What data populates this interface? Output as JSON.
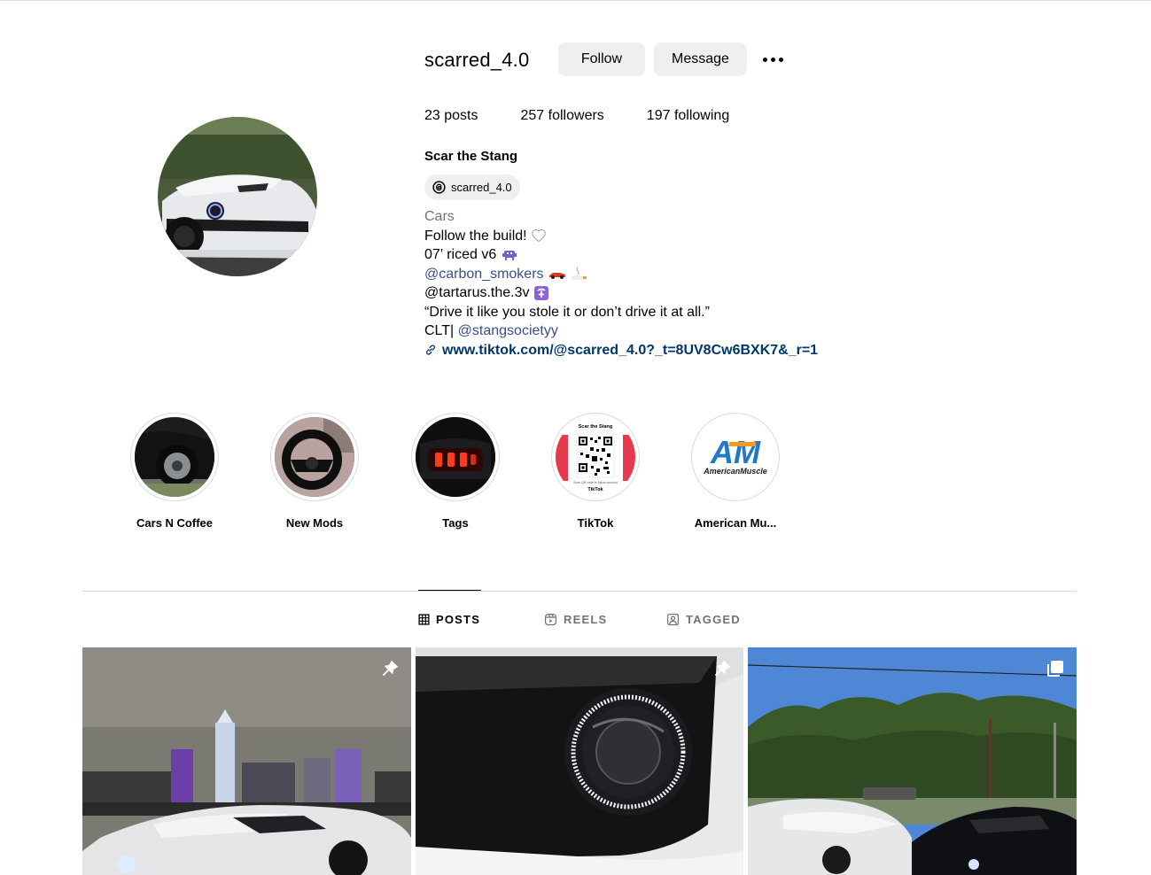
{
  "profile": {
    "username": "scarred_4.0",
    "follow_label": "Follow",
    "message_label": "Message",
    "more_icon": "more-horizontal-icon",
    "stats": {
      "posts_count": "23",
      "posts_label": "posts",
      "followers_count": "257",
      "followers_label": "followers",
      "following_count": "197",
      "following_label": "following"
    },
    "full_name": "Scar the Stang",
    "threads_handle": "scarred_4.0",
    "bio": {
      "category": "Cars",
      "line1": "Follow the build!",
      "line2": "07’ riced v6",
      "mention1": "@carbon_smokers",
      "line4": "@tartarus.the.3v",
      "quote": "“Drive it like you stole it or don’t drive it at all.”",
      "loc_prefix": "CLT|",
      "mention2": "@stangsocietyy",
      "link": "www.tiktok.com/@scarred_4.0?_t=8UV8Cw6BXK7&_r=1"
    }
  },
  "highlights": [
    {
      "label": "Cars N Coffee"
    },
    {
      "label": "New Mods"
    },
    {
      "label": "Tags"
    },
    {
      "label": "TikTok",
      "qr_title": "Scar the Stang",
      "qr_footer": "Scan QR code to follow account",
      "qr_brand": "TikTok"
    },
    {
      "label": "American Mu...",
      "logo_text": "AM",
      "logo_sub": "AmericanMuscle"
    }
  ],
  "tabs": [
    {
      "label": "POSTS",
      "icon": "grid-icon",
      "active": true
    },
    {
      "label": "REELS",
      "icon": "reels-icon",
      "active": false
    },
    {
      "label": "TAGGED",
      "icon": "tagged-icon",
      "active": false
    }
  ],
  "posts": [
    {
      "badge": "pin-icon"
    },
    {
      "badge": "pin-icon"
    },
    {
      "badge": "carousel-icon"
    }
  ],
  "colors": {
    "button_bg": "#efefef",
    "link": "#00376b",
    "mention": "#385185",
    "secondary_text": "#737373",
    "divider": "#dbdbdb"
  }
}
